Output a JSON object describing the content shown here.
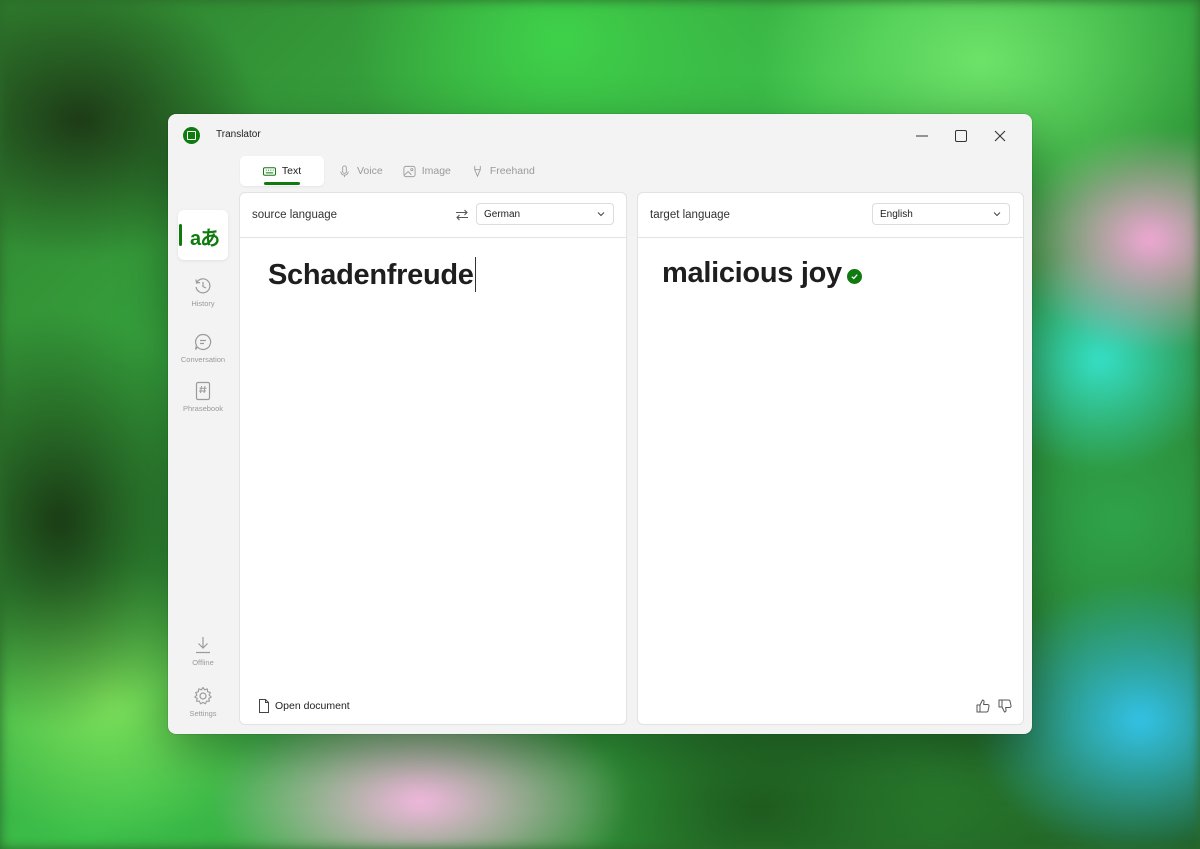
{
  "window": {
    "title": "Translator",
    "accent": "#0f7b0f"
  },
  "window_controls": {
    "minimize_icon": "minimize-icon",
    "maximize_icon": "maximize-icon",
    "close_icon": "close-icon"
  },
  "tabs": [
    {
      "label": "Text",
      "icon": "keyboard-icon",
      "active": true
    },
    {
      "label": "Voice",
      "icon": "microphone-icon",
      "active": false
    },
    {
      "label": "Image",
      "icon": "image-icon",
      "active": false
    },
    {
      "label": "Freehand",
      "icon": "pen-icon",
      "active": false
    }
  ],
  "rail": {
    "translate_glyph": "aあ",
    "items": [
      {
        "label": "History",
        "icon": "history-icon"
      },
      {
        "label": "Conversation",
        "icon": "chat-icon"
      },
      {
        "label": "Phrasebook",
        "icon": "phrasebook-icon"
      }
    ],
    "bottom": [
      {
        "label": "Offline",
        "icon": "download-icon"
      },
      {
        "label": "Settings",
        "icon": "gear-icon"
      }
    ]
  },
  "source": {
    "heading": "source language",
    "language": "German",
    "text": "Schadenfreude",
    "open_document": "Open document"
  },
  "target": {
    "heading": "target language",
    "language": "English",
    "text": "malicious joy"
  }
}
